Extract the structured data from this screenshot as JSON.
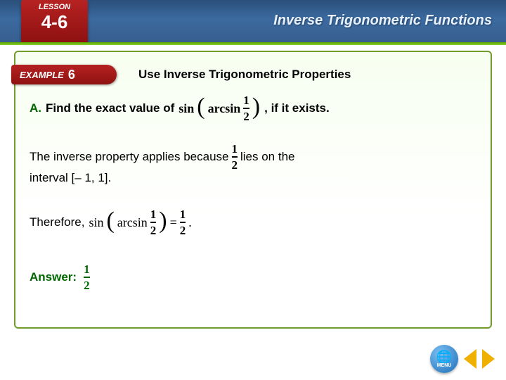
{
  "header": {
    "lesson_label": "LESSON",
    "lesson_num": "4-6",
    "topic": "Inverse Trigonometric Functions"
  },
  "example": {
    "label": "EXAMPLE",
    "number": "6",
    "title": "Use Inverse Trigonometric Properties"
  },
  "content": {
    "partA_label": "A.",
    "prompt_before": "Find the exact value of",
    "prompt_after": ", if it exists.",
    "expr1_func": "sin",
    "expr1_inner": "arcsin",
    "frac12_num": "1",
    "frac12_den": "2",
    "explain_before": "The inverse property applies because",
    "explain_after1": "lies on the",
    "explain_after2": "interval [– 1, 1].",
    "therefore": "Therefore,",
    "eq_eq": "=",
    "eq_period": ".",
    "answer_label": "Answer:",
    "answer_num": "1",
    "answer_den": "2"
  },
  "nav": {
    "menu": "MENU"
  }
}
